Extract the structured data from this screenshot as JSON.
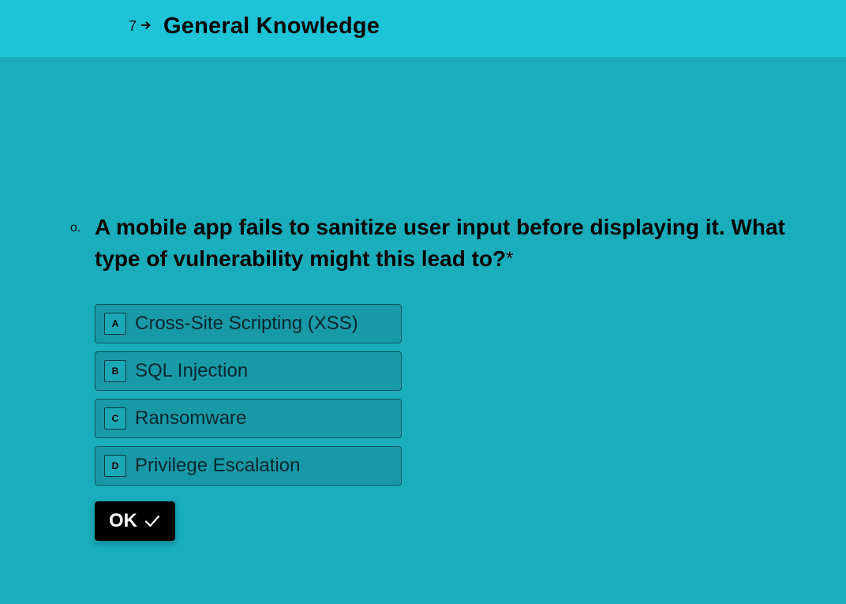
{
  "header": {
    "question_number": "7",
    "arrow_icon": "arrow-right-icon",
    "title": "General Knowledge"
  },
  "question": {
    "marker": "o.",
    "text": "A mobile app fails to sanitize user input before displaying it. What type of vulnerability might this lead to?",
    "required_mark": "*"
  },
  "choices": [
    {
      "key": "A",
      "label": "Cross-Site Scripting (XSS)"
    },
    {
      "key": "B",
      "label": "SQL Injection"
    },
    {
      "key": "C",
      "label": "Ransomware"
    },
    {
      "key": "D",
      "label": "Privilege Escalation"
    }
  ],
  "ok_button": {
    "label": "OK",
    "icon": "checkmark-icon"
  },
  "colors": {
    "page_background": "#1aadbc",
    "header_background": "#1dc3d6",
    "choice_background": "#1899a8",
    "button_background": "#000000"
  }
}
